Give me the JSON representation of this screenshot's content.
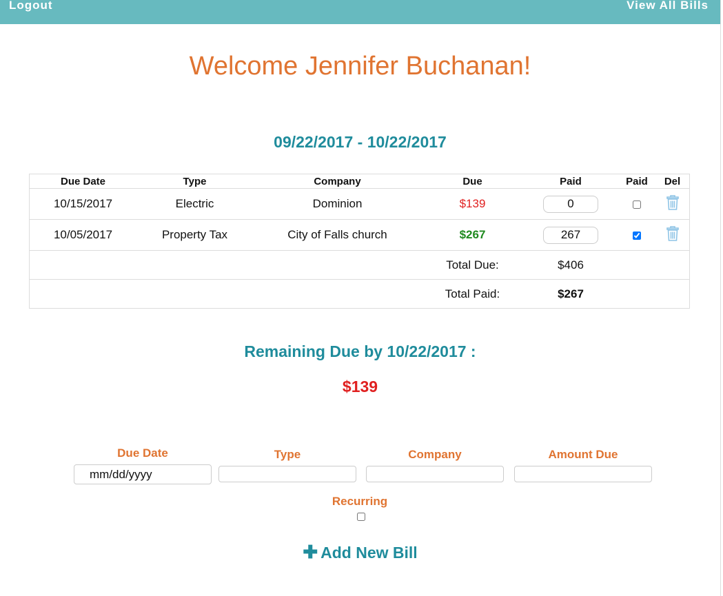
{
  "nav": {
    "logout": "Logout",
    "view_all": "View All Bills"
  },
  "welcome": "Welcome Jennifer Buchanan!",
  "date_range": "09/22/2017 - 10/22/2017",
  "table": {
    "headers": [
      "Due Date",
      "Type",
      "Company",
      "Due",
      "Paid",
      "Paid",
      "Del"
    ],
    "rows": [
      {
        "due_date": "10/15/2017",
        "type": "Electric",
        "company": "Dominion",
        "due": "$139",
        "paid_value": "0",
        "paid_checked": false
      },
      {
        "due_date": "10/05/2017",
        "type": "Property Tax",
        "company": "City of Falls church",
        "due": "$267",
        "paid_value": "267",
        "paid_checked": true
      }
    ],
    "total_due_label": "Total Due:",
    "total_due": "$406",
    "total_paid_label": "Total Paid:",
    "total_paid": "$267"
  },
  "remaining": {
    "label": "Remaining Due by 10/22/2017 :",
    "amount": "$139"
  },
  "form": {
    "due_date_label": "Due Date",
    "due_date_value": "mm/dd/yyyy",
    "type_label": "Type",
    "company_label": "Company",
    "amount_label": "Amount Due",
    "recurring_label": "Recurring",
    "add_label": "Add New Bill"
  },
  "colors": {
    "accent": "#67babf",
    "teal_text": "#1f8c9c",
    "orange": "#e07431",
    "red": "#e02020",
    "green": "#1f8a1f"
  },
  "icons": {
    "delete": "trash-icon",
    "add": "plus-icon"
  }
}
